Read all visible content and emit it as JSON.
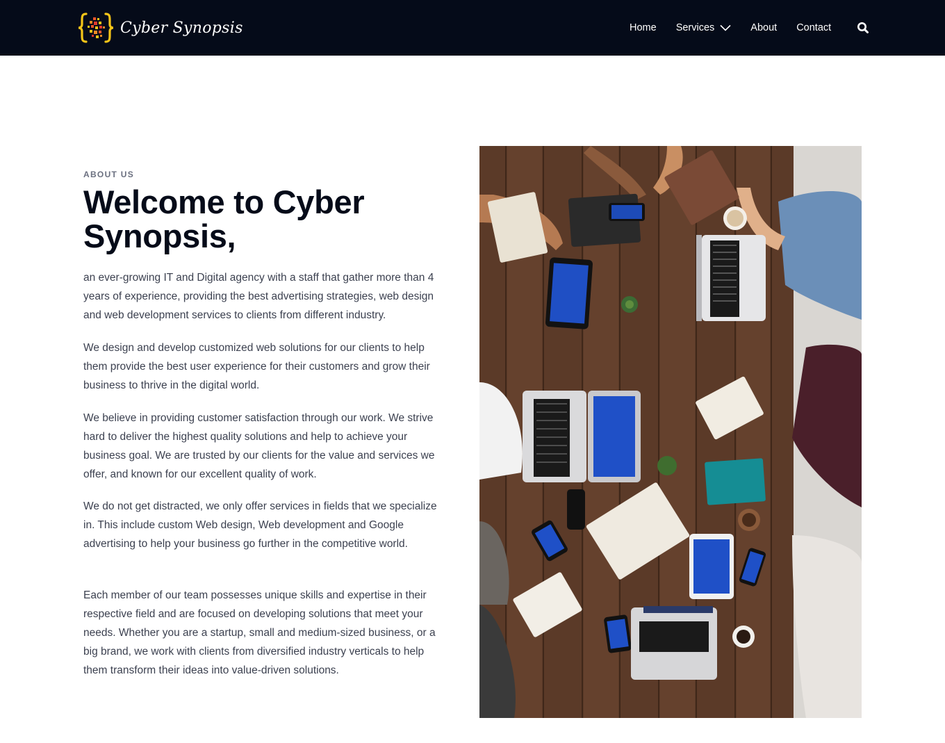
{
  "header": {
    "brand_name": "Cyber Synopsis",
    "logo_icon": "curly-braces-pixel-logo",
    "nav": [
      {
        "label": "Home"
      },
      {
        "label": "Services",
        "has_dropdown": true
      },
      {
        "label": "About"
      },
      {
        "label": "Contact"
      }
    ],
    "search_icon": "search-icon"
  },
  "about": {
    "eyebrow": "ABOUT US",
    "title": "Welcome to Cyber Synopsis,",
    "paragraphs": [
      "an ever-growing IT and Digital agency with a staff that gather more than 4 years of experience, providing the best advertising strategies, web design and web development services to clients from different industry.",
      "We design and develop customized web solutions for our clients to help them provide the best user experience for their customers and grow their business to thrive in the digital world.",
      "We believe in providing customer satisfaction through our work. We strive hard to deliver the highest quality solutions and help to achieve your business goal. We are trusted by our clients for the value and services we offer, and known for our excellent quality of work.",
      "We do not get distracted, we only offer services in fields that we specialize in. This include custom Web design, Web development and Google advertising to help your business go further in the competitive world.",
      "Each member of our team possesses unique skills and expertise in their respective field and are focused on developing solutions that meet your needs. Whether you are a startup, small and medium-sized business, or a big brand, we work with clients from diversified industry verticals to help them transform their ideas into value-driven solutions."
    ]
  },
  "image": {
    "subject": "team-meeting-table-photo"
  },
  "colors": {
    "header_bg": "#050b19",
    "title": "#050b19",
    "body_text": "#3c4150",
    "logo_yellow": "#f5c518"
  }
}
